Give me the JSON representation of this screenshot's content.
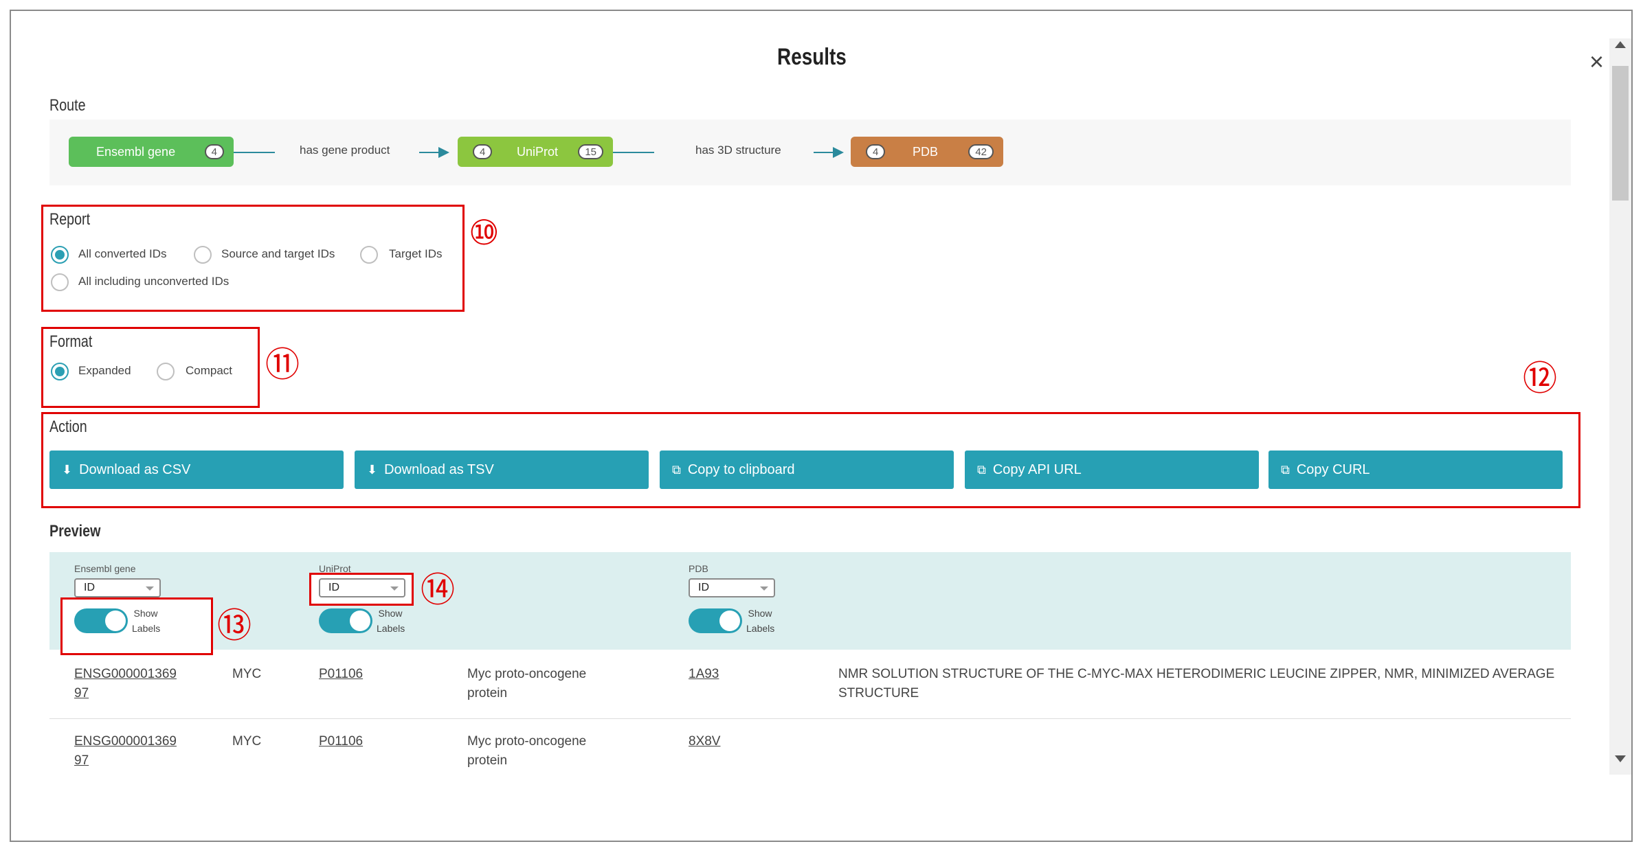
{
  "dialog": {
    "title": "Results",
    "close_glyph": "×"
  },
  "route": {
    "label": "Route",
    "nodes": [
      {
        "name": "Ensembl gene",
        "in_count": "",
        "out_count": "4",
        "color": "#5cbf5a"
      },
      {
        "name": "UniProt",
        "in_count": "4",
        "out_count": "15",
        "color": "#8cc63f"
      },
      {
        "name": "PDB",
        "in_count": "4",
        "out_count": "42",
        "color": "#c97f45"
      }
    ],
    "edges": [
      "has gene product",
      "has 3D structure"
    ]
  },
  "report": {
    "label": "Report",
    "options": [
      {
        "label": "All converted IDs",
        "selected": true
      },
      {
        "label": "Source and target IDs",
        "selected": false
      },
      {
        "label": "Target IDs",
        "selected": false
      },
      {
        "label": "All including unconverted IDs",
        "selected": false
      }
    ]
  },
  "format": {
    "label": "Format",
    "options": [
      {
        "label": "Expanded",
        "selected": true
      },
      {
        "label": "Compact",
        "selected": false
      }
    ]
  },
  "action": {
    "label": "Action",
    "buttons": [
      {
        "label": "Download as CSV",
        "icon": "download-icon",
        "glyph": "⬇"
      },
      {
        "label": "Download as TSV",
        "icon": "download-icon",
        "glyph": "⬇"
      },
      {
        "label": "Copy to clipboard",
        "icon": "copy-icon",
        "glyph": "⧉"
      },
      {
        "label": "Copy API URL",
        "icon": "copy-icon",
        "glyph": "⧉"
      },
      {
        "label": "Copy CURL",
        "icon": "copy-icon",
        "glyph": "⧉"
      }
    ]
  },
  "preview": {
    "label": "Preview",
    "columns": [
      {
        "title": "Ensembl gene",
        "select_value": "ID",
        "toggle_label": "Show Labels",
        "toggle_on": true
      },
      {
        "title": "UniProt",
        "select_value": "ID",
        "toggle_label": "Show Labels",
        "toggle_on": true
      },
      {
        "title": "PDB",
        "select_value": "ID",
        "toggle_label": "Show Labels",
        "toggle_on": true
      }
    ],
    "rows": [
      {
        "ensembl_id": "ENSG000001369 97",
        "ensembl_label": "MYC",
        "uniprot_id": "P01106",
        "uniprot_label": "Myc proto-oncogene protein",
        "pdb_id": "1A93",
        "pdb_label": "NMR SOLUTION STRUCTURE OF THE C-MYC-MAX HETERODIMERIC LEUCINE ZIPPER, NMR, MINIMIZED AVERAGE STRUCTURE"
      },
      {
        "ensembl_id": "ENSG000001369 97",
        "ensembl_label": "MYC",
        "uniprot_id": "P01106",
        "uniprot_label": "Myc proto-oncogene protein",
        "pdb_id": "8X8V",
        "pdb_label": ""
      }
    ]
  },
  "annotations": {
    "m10": "⑩",
    "m11": "⑪",
    "m12": "⑫",
    "m13": "⑬",
    "m14": "⑭"
  },
  "colors": {
    "accent": "#27a0b4",
    "annotation_red": "#e00000",
    "preview_bg": "#dcefef"
  }
}
